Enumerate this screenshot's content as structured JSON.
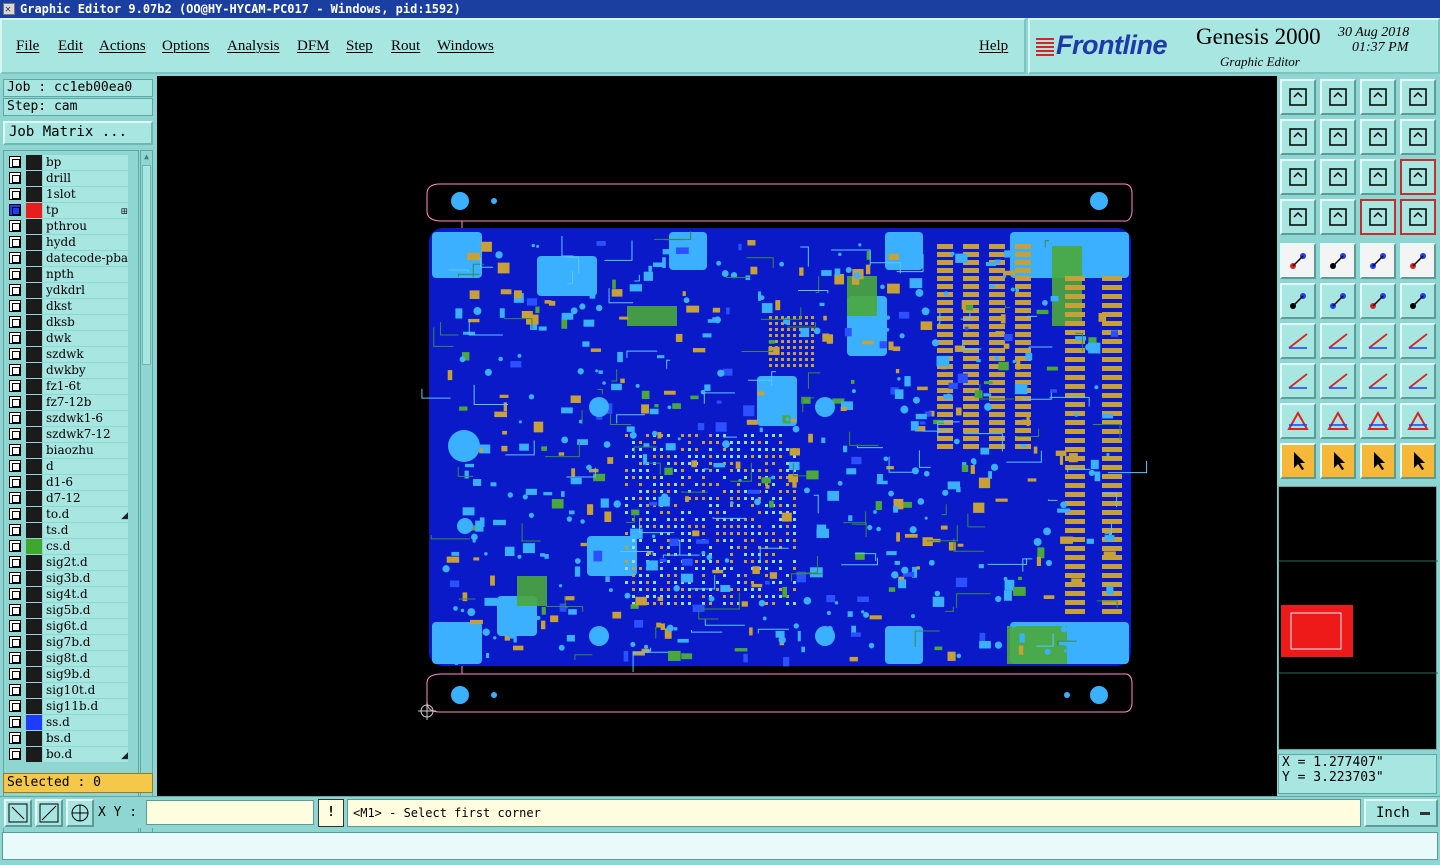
{
  "window": {
    "title": "Graphic Editor 9.07b2 (OO@HY-HYCAM-PC017 - Windows, pid:1592)"
  },
  "menu": {
    "items": [
      "File",
      "Edit",
      "Actions",
      "Options",
      "Analysis",
      "DFM",
      "Step",
      "Rout",
      "Windows"
    ],
    "help": "Help"
  },
  "brand": {
    "logo": "Frontline",
    "product": "Genesis 2000",
    "subtitle": "Graphic Editor",
    "date": "30 Aug 2018",
    "time": "01:37 PM"
  },
  "job": {
    "job_label": "Job : cc1eb00ea0",
    "step_label": "Step: cam",
    "matrix_button": "Job Matrix ..."
  },
  "layers": [
    {
      "name": "bp",
      "color": "#1b1b1b"
    },
    {
      "name": "drill",
      "color": "#1b1b1b"
    },
    {
      "name": "1slot",
      "color": "#1b1b1b"
    },
    {
      "name": "tp",
      "color": "#e81e1e",
      "active": true
    },
    {
      "name": "pthrou",
      "color": "#1b1b1b"
    },
    {
      "name": "hydd",
      "color": "#1b1b1b"
    },
    {
      "name": "datecode-pba",
      "color": "#1b1b1b"
    },
    {
      "name": "npth",
      "color": "#1b1b1b"
    },
    {
      "name": "ydkdrl",
      "color": "#1b1b1b"
    },
    {
      "name": "dkst",
      "color": "#1b1b1b"
    },
    {
      "name": "dksb",
      "color": "#1b1b1b"
    },
    {
      "name": "dwk",
      "color": "#1b1b1b"
    },
    {
      "name": "szdwk",
      "color": "#1b1b1b"
    },
    {
      "name": "dwkby",
      "color": "#1b1b1b"
    },
    {
      "name": "fz1-6t",
      "color": "#1b1b1b"
    },
    {
      "name": "fz7-12b",
      "color": "#1b1b1b"
    },
    {
      "name": "szdwk1-6",
      "color": "#1b1b1b"
    },
    {
      "name": "szdwk7-12",
      "color": "#1b1b1b"
    },
    {
      "name": "biaozhu",
      "color": "#1b1b1b"
    },
    {
      "name": "d",
      "color": "#1b1b1b"
    },
    {
      "name": "d1-6",
      "color": "#1b1b1b"
    },
    {
      "name": "d7-12",
      "color": "#1b1b1b"
    },
    {
      "name": "to.d",
      "color": "#1b1b1b",
      "mark": "◢"
    },
    {
      "name": "ts.d",
      "color": "#1b1b1b"
    },
    {
      "name": "cs.d",
      "color": "#3ea82e"
    },
    {
      "name": "sig2t.d",
      "color": "#1b1b1b"
    },
    {
      "name": "sig3b.d",
      "color": "#1b1b1b"
    },
    {
      "name": "sig4t.d",
      "color": "#1b1b1b"
    },
    {
      "name": "sig5b.d",
      "color": "#1b1b1b"
    },
    {
      "name": "sig6t.d",
      "color": "#1b1b1b"
    },
    {
      "name": "sig7b.d",
      "color": "#1b1b1b"
    },
    {
      "name": "sig8t.d",
      "color": "#1b1b1b"
    },
    {
      "name": "sig9b.d",
      "color": "#1b1b1b"
    },
    {
      "name": "sig10t.d",
      "color": "#1b1b1b"
    },
    {
      "name": "sig11b.d",
      "color": "#1b1b1b"
    },
    {
      "name": "ss.d",
      "color": "#1e3cff"
    },
    {
      "name": "bs.d",
      "color": "#1b1b1b"
    },
    {
      "name": "bo.d",
      "color": "#1b1b1b",
      "mark": "◢"
    }
  ],
  "selected_label": "Selected : 0",
  "coords": {
    "x_label": "X = 1.277407\"",
    "y_label": "Y = 3.223703\""
  },
  "bottom": {
    "xy_label": "X Y :",
    "xy_value": "",
    "excl": "!",
    "prompt": "<M1> - Select first corner",
    "units": "Inch"
  },
  "toolbar_icons": [
    "open-icon",
    "save-icon",
    "home-icon",
    "window-icon",
    "zoom-prev-icon",
    "zoom-next-icon",
    "undo-zoom-icon",
    "pan-icon",
    "fit-icon",
    "center-icon",
    "scale-1-2-icon",
    "help-icon",
    "measure-icon",
    "snap-icon",
    "layers-icon",
    "layers-alt-icon",
    "pad-icon",
    "line-icon",
    "ruler-icon",
    "dot-icon",
    "connect-icon",
    "cross-icon",
    "arc-icon",
    "arc-alt-icon",
    "angle-icon",
    "slash-icon",
    "rotate-icon",
    "mirror-icon",
    "shape-icon",
    "line-red-icon",
    "bridge-icon",
    "net-icon",
    "tri-icon",
    "tri-alt-icon",
    "tri-box-icon",
    "tri-wave-icon",
    "select-icon",
    "select-box-icon",
    "select-alt-icon",
    "select-net-icon"
  ],
  "colors": {
    "panel": "#8fd6d2",
    "canvas": "#000000",
    "copper_blue": "#1e3cff",
    "pad_cyan": "#3ab0ff",
    "pad_gold": "#c8a038",
    "outline_pink": "#ff7ab8",
    "selected_highlight": "#f5c84a"
  }
}
